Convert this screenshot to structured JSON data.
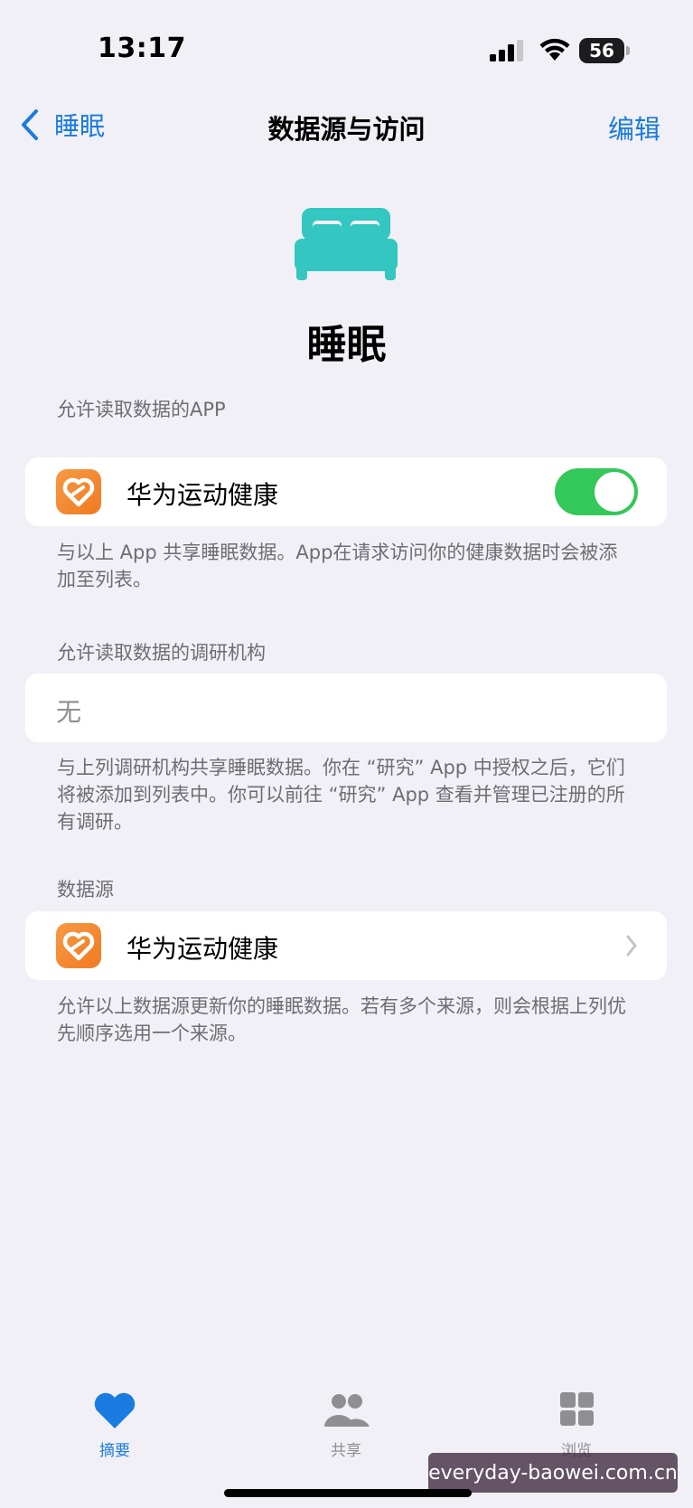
{
  "status_bar": {
    "time": "13:17",
    "battery_level": "56",
    "signal_bars": 3,
    "wifi": true
  },
  "nav": {
    "back_label": "睡眠",
    "title": "数据源与访问",
    "edit_label": "编辑"
  },
  "hero": {
    "icon": "bed-icon",
    "icon_color": "#34c6c0",
    "title": "睡眠"
  },
  "apps_section": {
    "header": "允许读取数据的APP",
    "items": [
      {
        "name": "华为运动健康",
        "enabled": true
      }
    ],
    "footer": "与以上 App 共享睡眠数据。App在请求访问你的健康数据时会被添加至列表。"
  },
  "research_section": {
    "header": "允许读取数据的调研机构",
    "value": "无",
    "footer": "与上列调研机构共享睡眠数据。你在 “研究” App 中授权之后，它们将被添加到列表中。你可以前往 “研究” App 查看并管理已注册的所有调研。"
  },
  "sources_section": {
    "header": "数据源",
    "items": [
      {
        "name": "华为运动健康"
      }
    ],
    "footer": "允许以上数据源更新你的睡眠数据。若有多个来源，则会根据上列优先顺序选用一个来源。"
  },
  "tab_bar": {
    "tabs": [
      {
        "label": "摘要",
        "icon": "heart-icon",
        "active": true
      },
      {
        "label": "共享",
        "icon": "people-icon",
        "active": false
      },
      {
        "label": "浏览",
        "icon": "grid-icon",
        "active": false
      }
    ]
  },
  "watermark": "everyday-baowei.com.cn",
  "colors": {
    "accent": "#1a7be0",
    "toggle_on": "#34c759",
    "background": "#f1f0f6",
    "app_icon": "#f58830"
  }
}
